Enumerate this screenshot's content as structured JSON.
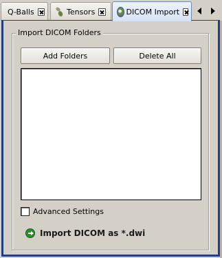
{
  "tabs": [
    {
      "label": "Q-Balls",
      "icon": "none",
      "active": false
    },
    {
      "label": "Tensors",
      "icon": "tensors-icon",
      "active": false
    },
    {
      "label": "DICOM Import",
      "icon": "dicom-icon",
      "active": true
    }
  ],
  "group": {
    "title": "Import DICOM Folders"
  },
  "buttons": {
    "add_label": "Add Folders",
    "delete_label": "Delete All"
  },
  "folder_list": {
    "items": []
  },
  "advanced": {
    "label": "Advanced Settings",
    "checked": false
  },
  "import_action": {
    "label": "Import DICOM as *.dwi",
    "icon": "go-arrow-icon"
  },
  "colors": {
    "background": "#d4d0c8",
    "active_border": "#223e7f",
    "go_icon": "#2e8b2e"
  }
}
